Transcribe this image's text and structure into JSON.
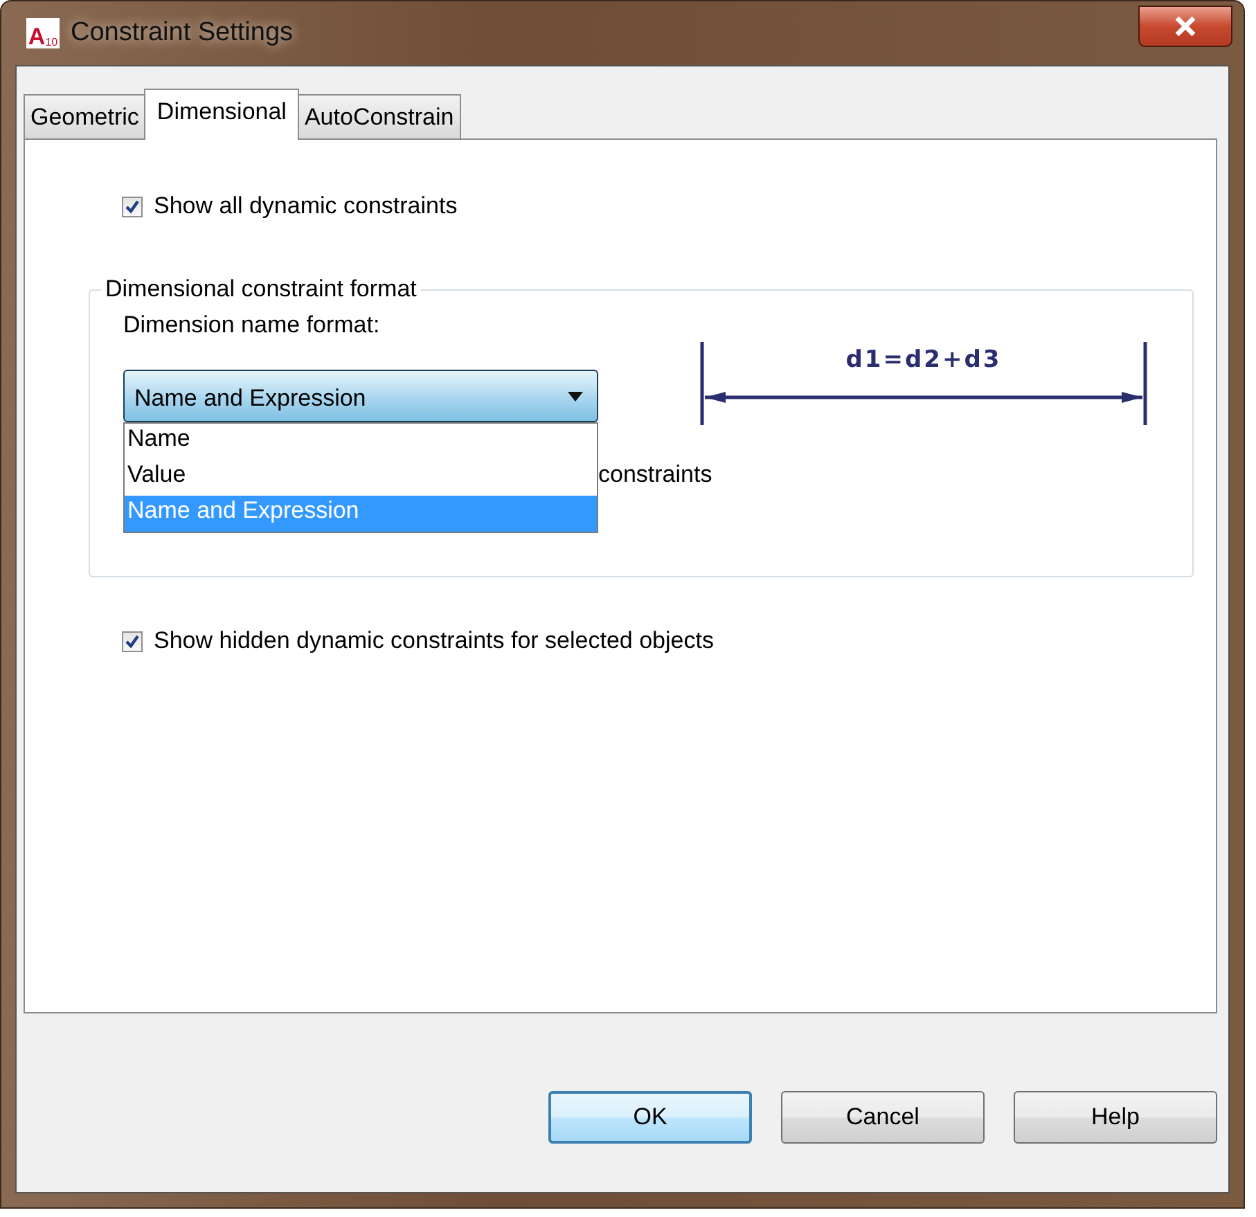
{
  "window": {
    "title": "Constraint Settings",
    "app_icon": {
      "letter": "A",
      "version": "10"
    }
  },
  "tabs": [
    {
      "label": "Geometric",
      "selected": false
    },
    {
      "label": "Dimensional",
      "selected": true
    },
    {
      "label": "AutoConstrain",
      "selected": false
    }
  ],
  "show_all_dynamic": {
    "label": "Show all dynamic constraints",
    "checked": true
  },
  "format_group": {
    "title": "Dimensional constraint format",
    "name_format_label": "Dimension name format:",
    "combo": {
      "value": "Name and Expression",
      "expanded": true,
      "options": [
        {
          "label": "Name",
          "selected": false
        },
        {
          "label": "Value",
          "selected": false
        },
        {
          "label": "Name and Expression",
          "selected": true
        }
      ]
    },
    "preview": {
      "expression": "d1=d2+d3"
    },
    "covered_option_label": "constraints"
  },
  "show_hidden": {
    "label": "Show hidden dynamic constraints for selected objects",
    "checked": true
  },
  "buttons": [
    {
      "label": "OK",
      "default": true
    },
    {
      "label": "Cancel",
      "default": false
    },
    {
      "label": "Help",
      "default": false
    }
  ]
}
